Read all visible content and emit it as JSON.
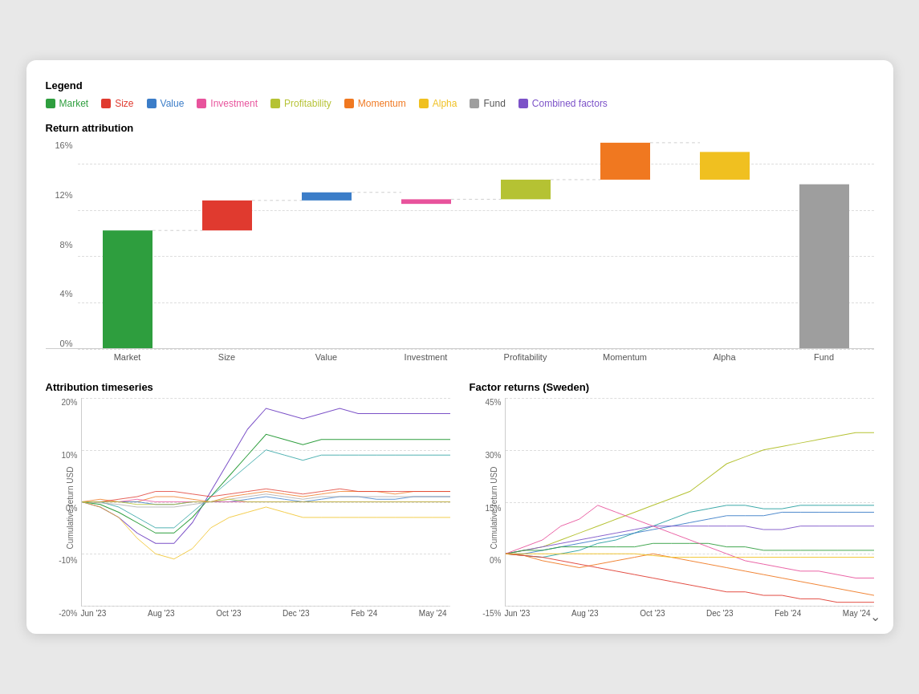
{
  "legend": {
    "title": "Legend",
    "items": [
      {
        "label": "Market",
        "color": "#2e9e3e",
        "textColor": "#2e9e3e"
      },
      {
        "label": "Size",
        "color": "#e03a2f",
        "textColor": "#e03a2f"
      },
      {
        "label": "Value",
        "color": "#3b7dc8",
        "textColor": "#3b7dc8"
      },
      {
        "label": "Investment",
        "color": "#e8539c",
        "textColor": "#e8539c"
      },
      {
        "label": "Profitability",
        "color": "#b5c233",
        "textColor": "#b5c233"
      },
      {
        "label": "Momentum",
        "color": "#f07820",
        "textColor": "#f07820"
      },
      {
        "label": "Alpha",
        "color": "#f0c020",
        "textColor": "#f0c020"
      },
      {
        "label": "Fund",
        "color": "#9e9e9e",
        "textColor": "#555"
      },
      {
        "label": "Combined factors",
        "color": "#7c52c8",
        "textColor": "#7c52c8"
      }
    ]
  },
  "returnAttribution": {
    "title": "Return attribution",
    "yLabels": [
      "16%",
      "12%",
      "8%",
      "4%",
      "0%"
    ],
    "bars": [
      {
        "label": "Market",
        "color": "#2e9e3e",
        "heightPct": 62,
        "stackBase": 0
      },
      {
        "label": "Size",
        "color": "#e03a2f",
        "heightPct": 25,
        "stackBase": 62
      },
      {
        "label": "Value",
        "color": "#3b7dc8",
        "heightPct": 12,
        "stackBase": 87
      },
      {
        "label": "Investment",
        "color": "#e8539c",
        "heightPct": 3,
        "stackBase": 87
      },
      {
        "label": "Profitability",
        "color": "#b5c233",
        "heightPct": 18,
        "stackBase": 87
      },
      {
        "label": "Momentum",
        "color": "#f07820",
        "heightPct": 28,
        "stackBase": 87
      },
      {
        "label": "Alpha",
        "color": "#f0c020",
        "heightPct": 22,
        "stackBase": 87
      },
      {
        "label": "Fund",
        "color": "#9e9e9e",
        "heightPct": 88,
        "stackBase": 0
      }
    ],
    "xLabels": [
      "Market",
      "Size",
      "Value",
      "Investment",
      "Profitability",
      "Momentum",
      "Alpha",
      "Fund"
    ]
  },
  "attributionTimeseries": {
    "title": "Attribution timeseries",
    "yLabels": [
      "20%",
      "10%",
      "0%",
      "-10%",
      "-20%"
    ],
    "xLabels": [
      "Jun '23",
      "Aug '23",
      "Oct '23",
      "Dec '23",
      "Feb '24",
      "May '24"
    ]
  },
  "factorReturns": {
    "title": "Factor returns (Sweden)",
    "yLabels": [
      "45%",
      "30%",
      "15%",
      "0%",
      "-15%"
    ],
    "xLabels": [
      "Jun '23",
      "Aug '23",
      "Oct '23",
      "Dec '23",
      "Feb '24",
      "May '24"
    ]
  },
  "chevron": "⌄"
}
